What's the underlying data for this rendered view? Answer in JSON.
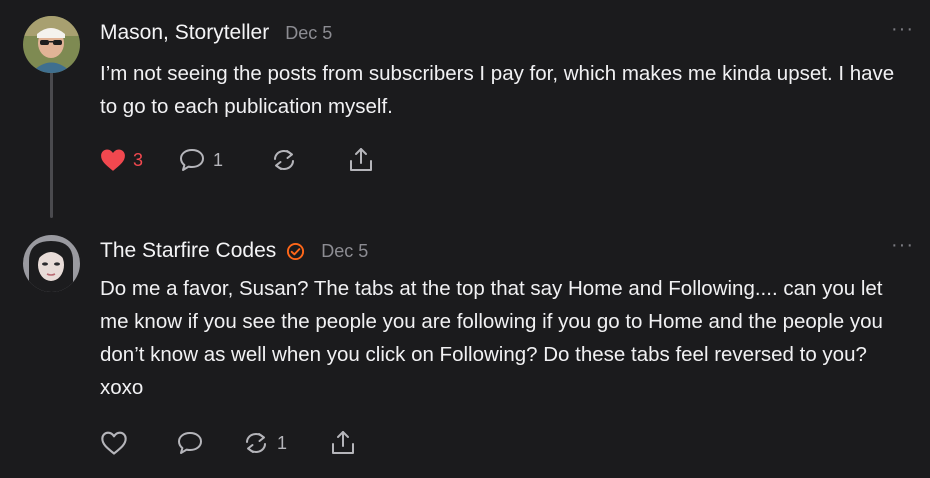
{
  "comments": [
    {
      "author": "Mason, Storyteller",
      "date": "Dec 5",
      "body": "I’m not seeing the posts from subscribers I pay for, which makes me kinda upset. I have to go to each publication myself.",
      "likes": "3",
      "liked": true,
      "replies": "1",
      "restacks": "",
      "more_label": "···"
    },
    {
      "author": "The Starfire Codes",
      "verified": true,
      "date": "Dec 5",
      "body": "Do me a favor, Susan? The tabs at the top that say Home and Following.... can you let me know if you see the people you are following if you go to Home and the people you don’t know as well when you click on Following? Do these tabs feel reversed to you? xoxo",
      "likes": "",
      "liked": false,
      "replies": "",
      "restacks": "1",
      "more_label": "···"
    }
  ],
  "colors": {
    "background": "#1b1b1d",
    "like_red": "#f1484f",
    "verified_orange": "#ff6719",
    "icon_gray": "#b5b5ba"
  },
  "icons": [
    "heart-icon",
    "comment-icon",
    "restack-icon",
    "share-icon",
    "verified-badge-icon",
    "more-icon"
  ]
}
